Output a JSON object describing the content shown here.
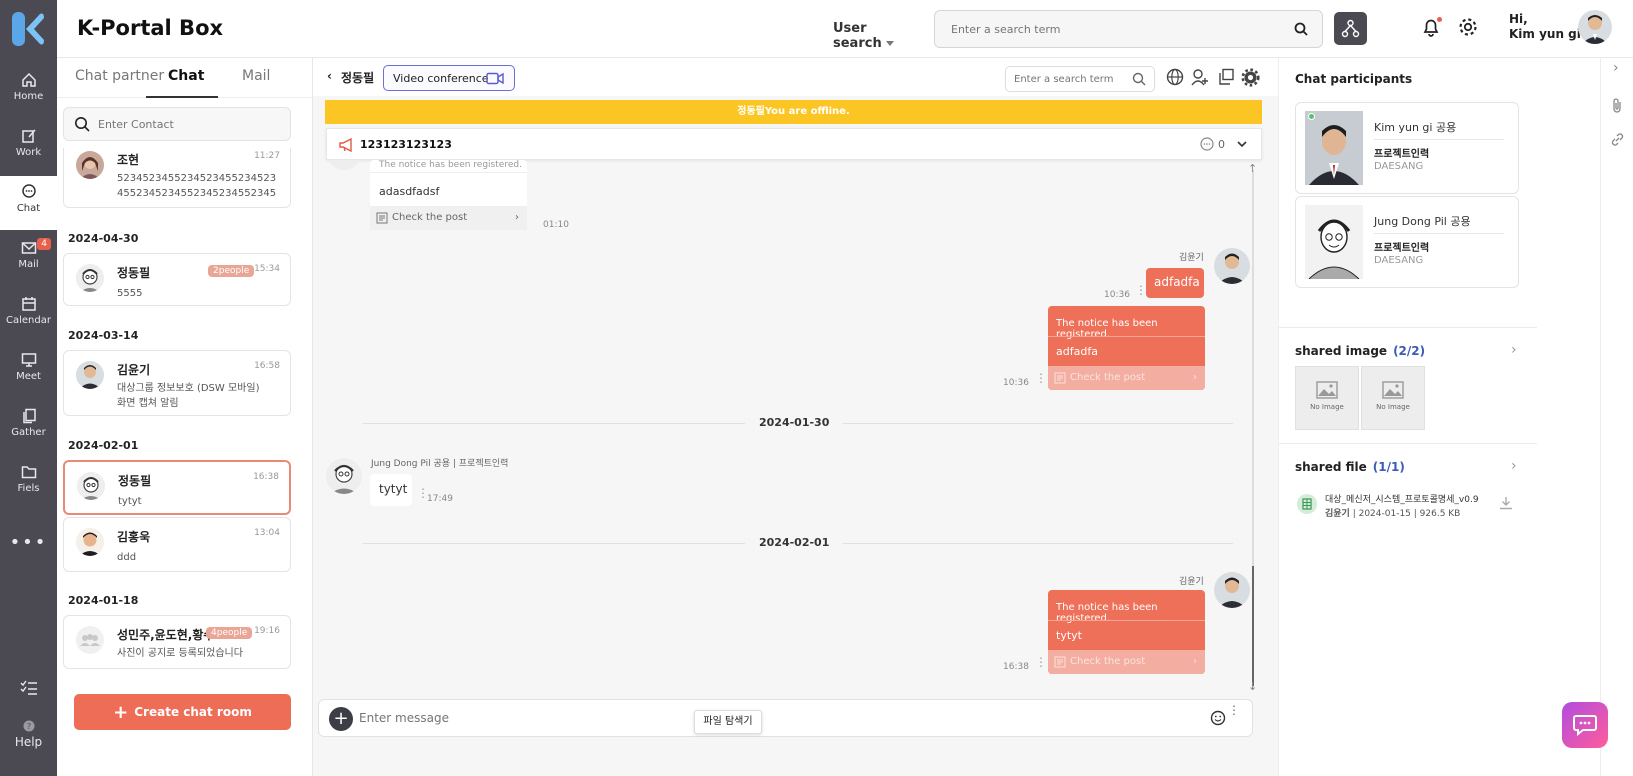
{
  "brand": "K-Portal Box",
  "rail": [
    {
      "label": "Home",
      "icon": "home-icon"
    },
    {
      "label": "Work",
      "icon": "edit-icon"
    },
    {
      "label": "Chat",
      "icon": "chat-icon",
      "active": true
    },
    {
      "label": "Mail",
      "icon": "mail-icon",
      "badge": "4"
    },
    {
      "label": "Calendar",
      "icon": "calendar-icon"
    },
    {
      "label": "Meet",
      "icon": "monitor-icon"
    },
    {
      "label": "Gather",
      "icon": "copy-icon"
    },
    {
      "label": "Fiels",
      "icon": "folder-icon"
    },
    {
      "label": "Help",
      "icon": "help-icon"
    }
  ],
  "header": {
    "user_search_label": "User search",
    "search_placeholder": "Enter a search term",
    "greeting_hi": "Hi,",
    "greeting_name": "Kim yun gi"
  },
  "list": {
    "tabs": [
      "Chat partner",
      "Chat",
      "Mail"
    ],
    "contact_placeholder": "Enter Contact",
    "create_label": "Create chat room",
    "groups": [
      {
        "date": "",
        "items": [
          {
            "name": "조현",
            "time": "11:27",
            "msg": "5234523455234523455234523455234523455234523455234552..."
          }
        ]
      },
      {
        "date": "2024-04-30",
        "items": [
          {
            "name": "정동필",
            "time": "15:34",
            "msg": "5555",
            "people": "2people"
          }
        ]
      },
      {
        "date": "2024-03-14",
        "items": [
          {
            "name": "김윤기",
            "time": "16:58",
            "msg": "대상그룹 정보보호 (DSW 모바일) 화면 캡쳐 알림"
          }
        ]
      },
      {
        "date": "2024-02-01",
        "items": [
          {
            "name": "정동필",
            "time": "16:38",
            "msg": "tytyt",
            "selected": true
          },
          {
            "name": "김홍욱",
            "time": "13:04",
            "msg": "ddd"
          }
        ]
      },
      {
        "date": "2024-01-18",
        "items": [
          {
            "name": "성민주,윤도현,황수",
            "time": "19:16",
            "msg": "사진이 공지로 등록되었습니다",
            "people": "4people"
          }
        ]
      }
    ]
  },
  "chat": {
    "room_name": "정동필",
    "video_conference": "Video conference",
    "search_placeholder": "Enter a search term",
    "offline_banner": "정동필You are offline.",
    "notice_text": "123123123123",
    "notice_count": "0",
    "messages": {
      "top_partial": {
        "notice": "The notice has been registered.",
        "body": "adasdfadsf",
        "post": "Check the post",
        "time": "01:10"
      },
      "mine_1": {
        "sender": "김윤기",
        "text": "adfadfa",
        "time": "10:36"
      },
      "mine_2": {
        "notice": "The notice has been registered.",
        "body": "adfadfa",
        "post": "Check the post",
        "time": "10:36"
      },
      "day_1": "2024-01-30",
      "theirs_1": {
        "sender": "Jung Dong Pil 공용 | 프로젝트인력",
        "text": "tytyt",
        "time": "17:49"
      },
      "day_2": "2024-02-01",
      "mine_3": {
        "sender": "김윤기",
        "notice": "The notice has been registered.",
        "body": "tytyt",
        "post": "Check the post",
        "time": "16:38"
      }
    },
    "input_placeholder": "Enter message",
    "tooltip": "파일 탐색기"
  },
  "right": {
    "participants_title": "Chat participants",
    "participants": [
      {
        "name": "Kim yun gi 공용",
        "dept": "프로젝트인력",
        "company": "DAESANG",
        "online": true
      },
      {
        "name": "Jung Dong Pil 공용",
        "dept": "프로젝트인력",
        "company": "DAESANG"
      }
    ],
    "shared_image_title": "shared image",
    "shared_image_count": "(2/2)",
    "no_image": "No Image",
    "shared_file_title": "shared file",
    "shared_file_count": "(1/1)",
    "file_name": "대상_메신저_시스템_프로토콜명세_v0.9",
    "file_meta_user": "김윤기",
    "file_meta_rest": " | 2024-01-15 | 926.5 KB"
  },
  "colors": {
    "accent": "#ee6d57",
    "rail": "#4b4a52",
    "banner": "#fbc624",
    "bubble": "#ef7059"
  }
}
